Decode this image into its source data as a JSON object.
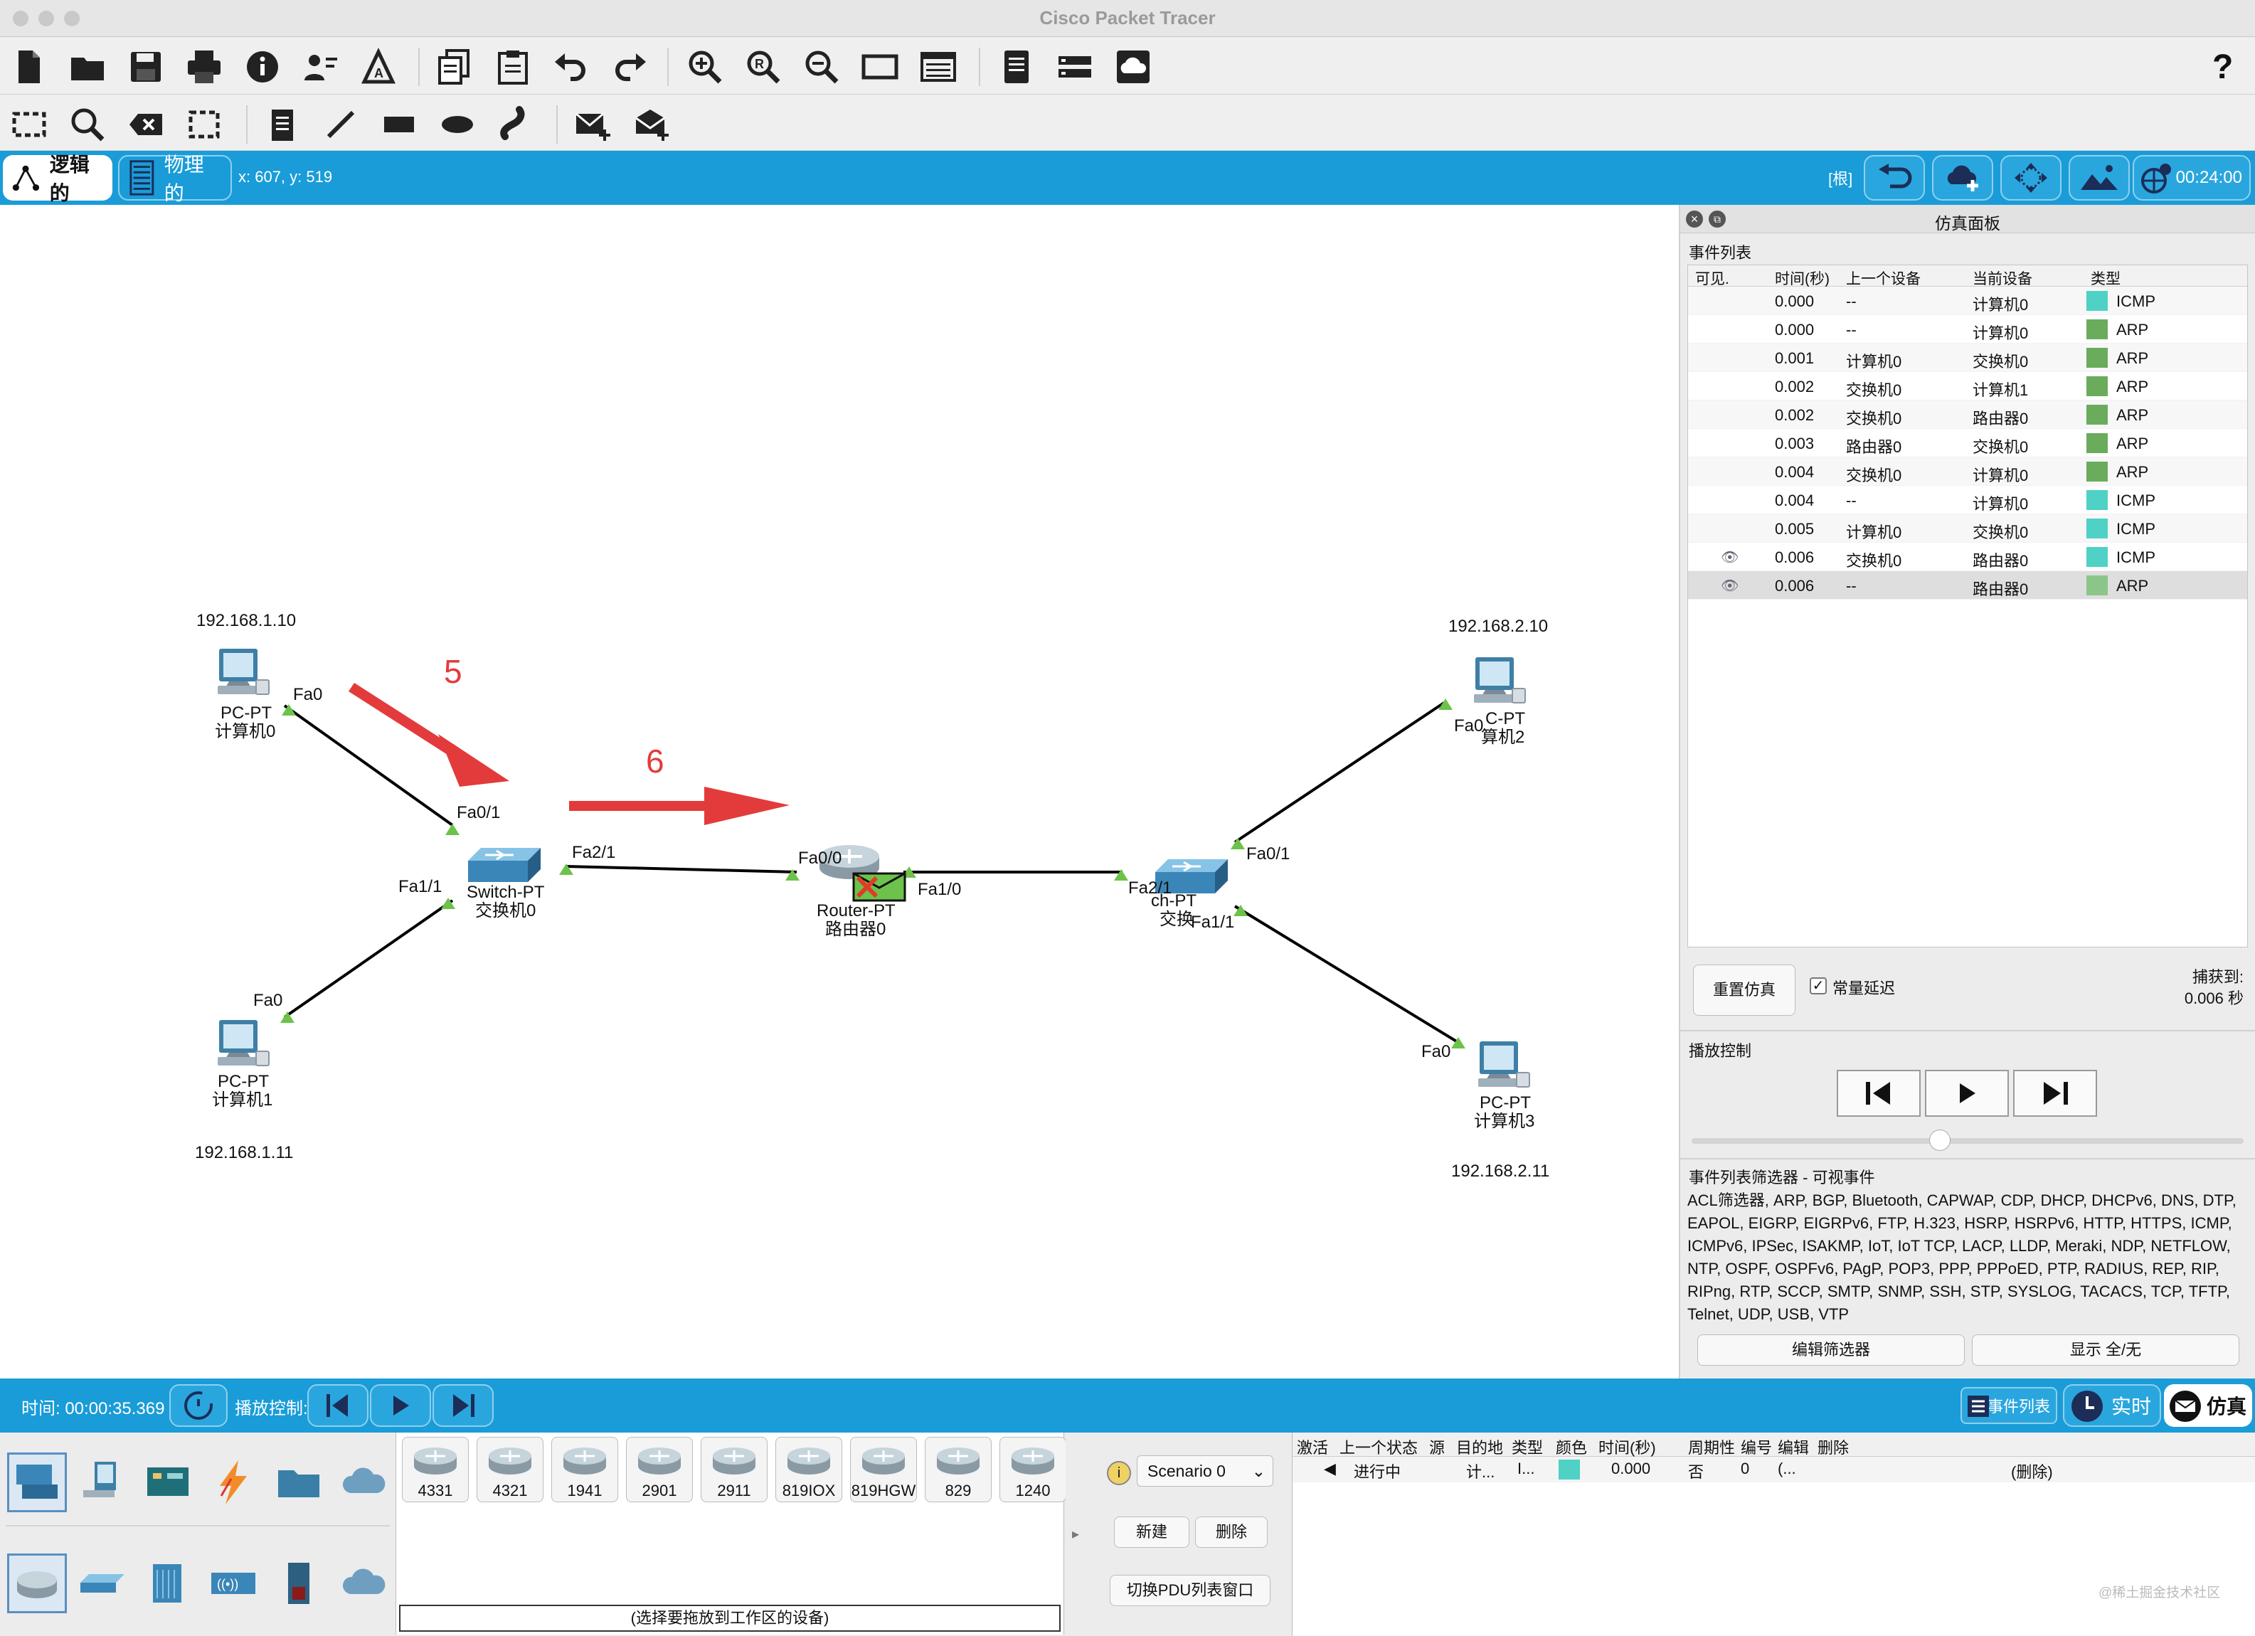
{
  "window": {
    "title": "Cisco Packet Tracer"
  },
  "toolbar": {
    "help": "?"
  },
  "modebar": {
    "logical": "逻辑的",
    "physical": "物理的",
    "coords": "x: 607, y: 519",
    "root": "[根]",
    "clock": "00:24:00"
  },
  "network": {
    "ips": {
      "pc0": "192.168.1.10",
      "pc1": "192.168.1.11",
      "pc2": "192.168.2.10",
      "pc3": "192.168.2.11"
    },
    "devices": {
      "pc0": {
        "model": "PC-PT",
        "name": "计算机0"
      },
      "pc1": {
        "model": "PC-PT",
        "name": "计算机1"
      },
      "pc2": {
        "model": "C-PT",
        "name": "算机2"
      },
      "pc3": {
        "model": "PC-PT",
        "name": "计算机3"
      },
      "sw0": {
        "model": "Switch-PT",
        "name": "交换机0"
      },
      "sw1": {
        "model": "ch-PT",
        "name": "交换"
      },
      "router": {
        "model": "Router-PT",
        "name": "路由器0"
      }
    },
    "ports": {
      "pc0": "Fa0",
      "sw0_a": "Fa0/1",
      "sw0_b": "Fa1/1",
      "sw0_c": "Fa2/1",
      "pc1": "Fa0",
      "r_a": "Fa0/0",
      "r_b": "Fa1/0",
      "sw1_c": "Fa2/1",
      "sw1_a": "Fa0/1",
      "sw1_b": "Fa1/1",
      "pc2": "Fa0",
      "pc3": "Fa0"
    },
    "annotations": {
      "a5": "5",
      "a6": "6"
    }
  },
  "sim_panel": {
    "title": "仿真面板",
    "event_list_label": "事件列表",
    "columns": [
      "可见.",
      "时间(秒)",
      "上一个设备",
      "当前设备",
      "类型"
    ],
    "events": [
      {
        "visible": "",
        "time": "0.000",
        "last": "--",
        "at": "计算机0",
        "type": "ICMP",
        "color": "#4fd1c5"
      },
      {
        "visible": "",
        "time": "0.000",
        "last": "--",
        "at": "计算机0",
        "type": "ARP",
        "color": "#6aac5c"
      },
      {
        "visible": "",
        "time": "0.001",
        "last": "计算机0",
        "at": "交换机0",
        "type": "ARP",
        "color": "#6aac5c"
      },
      {
        "visible": "",
        "time": "0.002",
        "last": "交换机0",
        "at": "计算机1",
        "type": "ARP",
        "color": "#6aac5c"
      },
      {
        "visible": "",
        "time": "0.002",
        "last": "交换机0",
        "at": "路由器0",
        "type": "ARP",
        "color": "#6aac5c"
      },
      {
        "visible": "",
        "time": "0.003",
        "last": "路由器0",
        "at": "交换机0",
        "type": "ARP",
        "color": "#6aac5c"
      },
      {
        "visible": "",
        "time": "0.004",
        "last": "交换机0",
        "at": "计算机0",
        "type": "ARP",
        "color": "#6aac5c"
      },
      {
        "visible": "",
        "time": "0.004",
        "last": "--",
        "at": "计算机0",
        "type": "ICMP",
        "color": "#4fd1c5"
      },
      {
        "visible": "",
        "time": "0.005",
        "last": "计算机0",
        "at": "交换机0",
        "type": "ICMP",
        "color": "#4fd1c5"
      },
      {
        "visible": "eye",
        "time": "0.006",
        "last": "交换机0",
        "at": "路由器0",
        "type": "ICMP",
        "color": "#4fd1c5"
      },
      {
        "visible": "eye",
        "time": "0.006",
        "last": "--",
        "at": "路由器0",
        "type": "ARP",
        "color": "#8cc58a"
      }
    ],
    "reset_label": "重置仿真",
    "constant_delay_label": "常量延迟",
    "constant_delay_checked": true,
    "captured_label": "捕获到:",
    "captured_value": "0.006 秒",
    "playback_label": "播放控制",
    "slider_level": 0.45,
    "filter_title": "事件列表筛选器 - 可视事件",
    "filter_text": "ACL筛选器, ARP, BGP, Bluetooth, CAPWAP, CDP, DHCP, DHCPv6, DNS, DTP, EAPOL, EIGRP, EIGRPv6, FTP, H.323, HSRP, HSRPv6, HTTP, HTTPS, ICMP, ICMPv6, IPSec, ISAKMP, IoT, IoT TCP, LACP, LLDP, Meraki, NDP, NETFLOW, NTP, OSPF, OSPFv6, PAgP, POP3, PPP, PPPoED, PTP, RADIUS, REP, RIP, RIPng, RTP, SCCP, SMTP, SNMP, SSH, STP, SYSLOG, TACACS, TCP, TFTP, Telnet, UDP, USB, VTP",
    "edit_filters_label": "编辑筛选器",
    "show_all_label": "显示 全/无"
  },
  "bottom_bar": {
    "time": "时间: 00:00:35.369",
    "playback": "播放控制:",
    "event_list": "事件列表",
    "realtime": "实时",
    "simulation": "仿真"
  },
  "device_models": [
    "4331",
    "4321",
    "1941",
    "2901",
    "2911",
    "819IOX",
    "819HGW",
    "829",
    "1240"
  ],
  "device_hint": "(选择要拖放到工作区的设备)",
  "scenario": {
    "selected": "Scenario 0",
    "new": "新建",
    "delete": "删除",
    "toggle_pdu": "切换PDU列表窗口"
  },
  "pdu_table": {
    "columns": [
      "激活",
      "上一个状态",
      "源",
      "目的地",
      "类型",
      "颜色",
      "时间(秒)",
      "周期性",
      "编号",
      "编辑",
      "删除"
    ],
    "row": {
      "active": "◀",
      "state": "进行中",
      "source": "计...",
      "dest": "I...",
      "type": "",
      "color": "#4fd1c5",
      "time": "0.000",
      "periodic": "否",
      "num": "0",
      "edit": "(...",
      "delete": "(删除)"
    }
  },
  "watermark": "@稀土掘金技术社区"
}
